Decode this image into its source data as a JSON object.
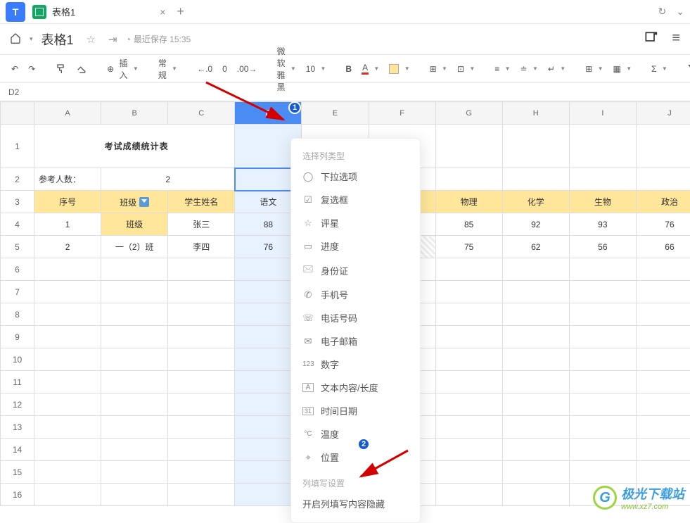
{
  "titlebar": {
    "tab_title": "表格1",
    "close_glyph": "×",
    "add_glyph": "+",
    "refresh_glyph": "↻",
    "down_glyph": "⌄"
  },
  "doc_header": {
    "home_caret": "▾",
    "doc_name": "表格1",
    "star_glyph": "☆",
    "folder_glyph": "⇥",
    "clock_glyph": "◔",
    "save_text": "最近保存 15:35",
    "share_glyph": "⎙",
    "menu_glyph": "≡"
  },
  "toolbar": {
    "undo_glyph": "↶",
    "redo_glyph": "↷",
    "format_glyph": "ᵀ",
    "clear_glyph": "◯",
    "insert_prefix": "⊕",
    "insert_label": "插入",
    "format_select": "常规",
    "decimal_value": "0",
    "font_name": "微软雅黑",
    "font_size": "10",
    "bold": "B",
    "text_color": "A",
    "fill_glyph": "◇",
    "border_glyph": "⊞",
    "merge_glyph": "⊡",
    "align_h_glyph": "≡",
    "align_v_glyph": "≐",
    "wrap_glyph": "↵",
    "freeze_glyph": "⊞",
    "cell_glyph": "▦",
    "sum_glyph": "Σ",
    "filter_glyph": "⫾"
  },
  "cell_ref": "D2",
  "columns": [
    "A",
    "B",
    "C",
    "D",
    "E",
    "F",
    "G",
    "H",
    "I",
    "J"
  ],
  "row_numbers": [
    "1",
    "2",
    "3",
    "4",
    "5",
    "6",
    "7",
    "8",
    "9",
    "10",
    "11",
    "12",
    "13",
    "14",
    "15",
    "16"
  ],
  "sheet": {
    "title": "考试成绩统计表",
    "row2_label": "参考人数：",
    "row2_value": "2",
    "headers": [
      "序号",
      "班级",
      "学生姓名",
      "语文",
      "",
      "",
      "物理",
      "化学",
      "生物",
      "政治"
    ],
    "data_rows": [
      [
        "1",
        "班级",
        "张三",
        "88",
        "",
        "",
        "85",
        "92",
        "93",
        "76"
      ],
      [
        "2",
        "一（2）班",
        "李四",
        "76",
        "",
        "",
        "75",
        "62",
        "56",
        "66"
      ]
    ]
  },
  "dropdown": {
    "group1": "选择列类型",
    "items": [
      {
        "icon": "◯",
        "label": "下拉选项"
      },
      {
        "icon": "☑",
        "label": "复选框"
      },
      {
        "icon": "☆",
        "label": "评星"
      },
      {
        "icon": "▭",
        "label": "进度"
      },
      {
        "icon": "🖂",
        "label": "身份证"
      },
      {
        "icon": "✆",
        "label": "手机号"
      },
      {
        "icon": "☏",
        "label": "电话号码"
      },
      {
        "icon": "✉",
        "label": "电子邮箱"
      },
      {
        "icon": "123",
        "label": "数字"
      },
      {
        "icon": "A",
        "label": "文本内容/长度"
      },
      {
        "icon": "31",
        "label": "时间日期"
      },
      {
        "icon": "°C",
        "label": "温度"
      },
      {
        "icon": "⌖",
        "label": "位置"
      }
    ],
    "group2": "列填写设置",
    "action": "开启列填写内容隐藏"
  },
  "markers": {
    "m1": "1",
    "m2": "2"
  },
  "watermark": {
    "logo": "G",
    "text1": "极光下载站",
    "text2": "www.xz7.com"
  }
}
